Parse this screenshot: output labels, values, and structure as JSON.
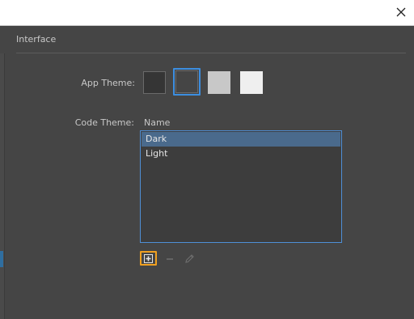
{
  "section": {
    "title": "Interface"
  },
  "app_theme": {
    "label": "App Theme:",
    "swatches": [
      {
        "name": "darkest",
        "color": "#353535",
        "selected": false
      },
      {
        "name": "dark",
        "color": "#454545",
        "selected": true
      },
      {
        "name": "light",
        "color": "#c8c8c8",
        "selected": false
      },
      {
        "name": "lightest",
        "color": "#efefef",
        "selected": false
      }
    ]
  },
  "code_theme": {
    "label": "Code Theme:",
    "column_header": "Name",
    "items": [
      {
        "label": "Dark",
        "selected": true
      },
      {
        "label": "Light",
        "selected": false
      }
    ]
  },
  "colors": {
    "accent": "#3c8ee0",
    "focus_highlight": "#f0a020",
    "selection": "#4a6a8c"
  },
  "icons": {
    "close": "close-icon",
    "add": "plus-icon",
    "remove": "minus-icon",
    "edit": "pencil-icon"
  }
}
